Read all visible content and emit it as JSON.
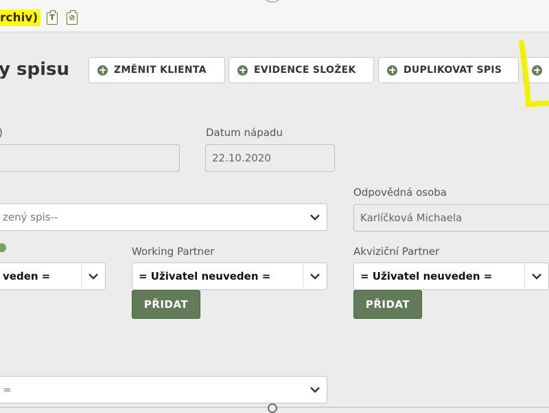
{
  "header": {
    "archive_badge": "rchiv)",
    "icon1": "clipboard-text-icon",
    "icon2": "clipboard-clip-icon"
  },
  "title": "y spisu",
  "actions": [
    {
      "label": "ZMĚNIT KLIENTA"
    },
    {
      "label": "EVIDENCE SLOŽEK"
    },
    {
      "label": "DUPLIKOVAT SPIS"
    },
    {
      "label": ""
    }
  ],
  "form": {
    "field_left_label": ")",
    "field_left_value": "",
    "datum_label": "Datum nápadu",
    "datum_value": "22.10.2020",
    "linked_select_value": "zený spis--",
    "responsible_label": "Odpovědná osoba",
    "responsible_value": "Karlíčková Michaela",
    "left_user_value": "veden =",
    "working_partner_label": "Working Partner",
    "working_partner_value": "= Uživatel neuveden =",
    "acq_partner_label": "Akviziční Partner",
    "acq_partner_value": "= Uživatel neuveden =",
    "add_label": "PŘIDAT",
    "bottom_select_value": "="
  },
  "colors": {
    "accent_green": "#627b58",
    "highlight_yellow": "#ffff00"
  }
}
